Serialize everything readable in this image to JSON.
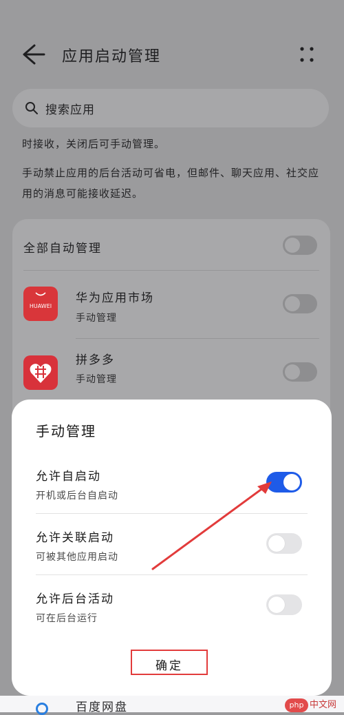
{
  "header": {
    "title": "应用启动管理"
  },
  "search": {
    "placeholder": "搜索应用"
  },
  "description": {
    "line1": "时接收，关闭后可手动管理。",
    "line2": "手动禁止应用的后台活动可省电，但邮件、聊天应用、社交应用的消息可能接收延迟。"
  },
  "list": {
    "all_label": "全部自动管理",
    "apps": [
      {
        "name": "华为应用市场",
        "status": "手动管理",
        "icon": "huawei-appgallery-icon",
        "icon_text": "HUAWEI",
        "icon_color": "#d9363a"
      },
      {
        "name": "拼多多",
        "status": "手动管理",
        "icon": "pinduoduo-icon",
        "icon_color": "#d8323b"
      }
    ],
    "peek_app": "百度网盘"
  },
  "dialog": {
    "title": "手动管理",
    "options": [
      {
        "label": "允许自启动",
        "sub": "开机或后台自启动",
        "enabled": true
      },
      {
        "label": "允许关联启动",
        "sub": "可被其他应用启动",
        "enabled": false
      },
      {
        "label": "允许后台活动",
        "sub": "可在后台运行",
        "enabled": false
      }
    ],
    "confirm_label": "确定"
  },
  "colors": {
    "accent": "#1e5be8",
    "annotation": "#e23b3b"
  },
  "watermark": {
    "php": "php",
    "cn": "中文网"
  }
}
